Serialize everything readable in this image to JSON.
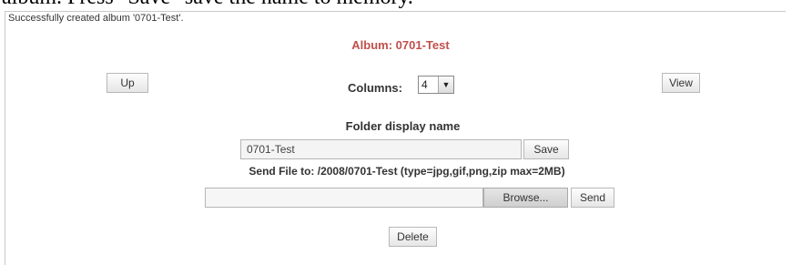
{
  "caption": "album. Press \"Save\" save the name to memory.",
  "status_message": "Successfully created album '0701-Test'.",
  "album_title": "Album: 0701-Test",
  "nav": {
    "up_label": "Up",
    "view_label": "View"
  },
  "columns": {
    "label": "Columns:",
    "selected": "4"
  },
  "folder": {
    "label": "Folder display name",
    "value": "0701-Test",
    "save_label": "Save"
  },
  "upload": {
    "label": "Send File to: /2008/0701-Test (type=jpg,gif,png,zip max=2MB)",
    "file_value": "",
    "browse_label": "Browse...",
    "send_label": "Send"
  },
  "delete_label": "Delete"
}
